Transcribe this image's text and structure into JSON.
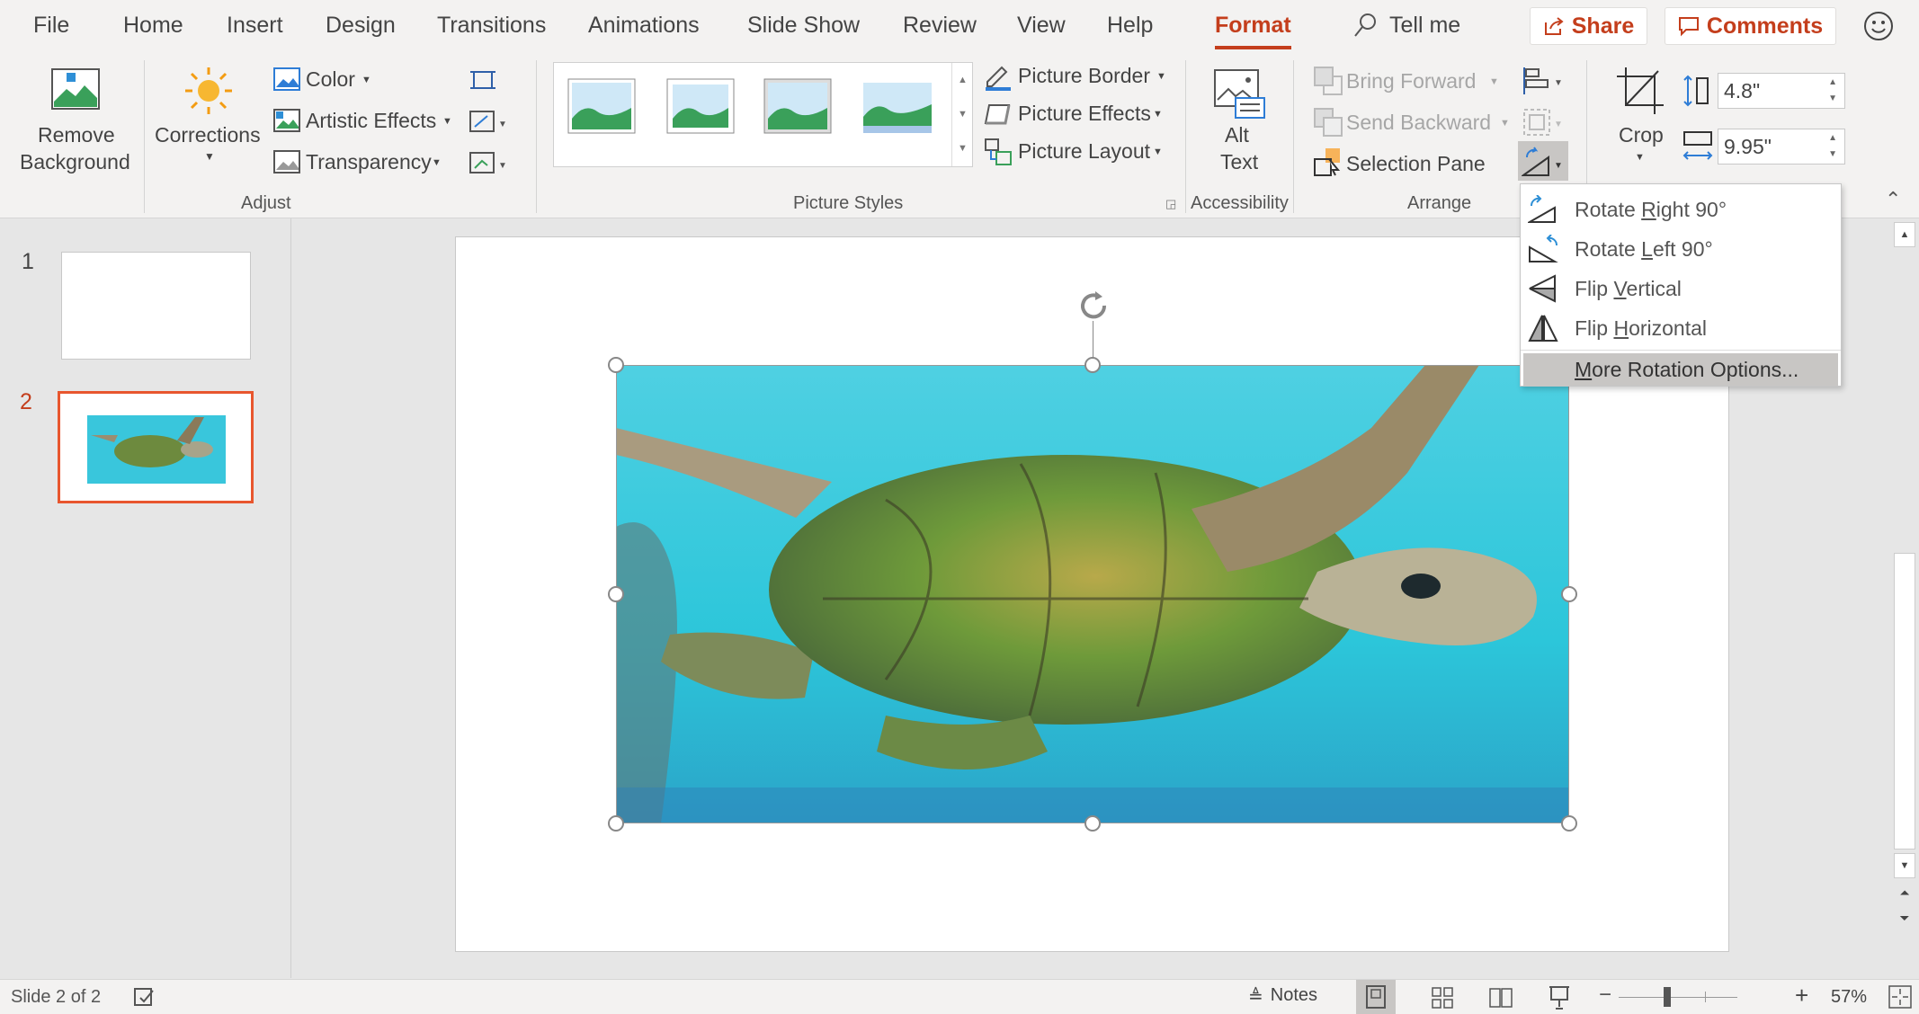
{
  "tabs": [
    "File",
    "Home",
    "Insert",
    "Design",
    "Transitions",
    "Animations",
    "Slide Show",
    "Review",
    "View",
    "Help",
    "Format"
  ],
  "active_tab": "Format",
  "tell_me": "Tell me",
  "share": "Share",
  "comments": "Comments",
  "accent": "#c43e1c",
  "ribbon": {
    "remove_background": [
      "Remove",
      "Background"
    ],
    "corrections": "Corrections",
    "color": "Color",
    "artistic_effects": "Artistic Effects",
    "transparency": "Transparency",
    "adjust": "Adjust",
    "picture_border": "Picture Border",
    "picture_effects": "Picture Effects",
    "picture_layout": "Picture Layout",
    "picture_styles": "Picture Styles",
    "alt_text": [
      "Alt",
      "Text"
    ],
    "accessibility": "Accessibility",
    "bring_forward": "Bring Forward",
    "send_backward": "Send Backward",
    "selection_pane": "Selection Pane",
    "arrange": "Arrange",
    "crop": "Crop",
    "height": "4.8\"",
    "width": "9.95\""
  },
  "rotate_menu": {
    "items": [
      {
        "pre": "Rotate ",
        "key": "R",
        "post": "ight 90°",
        "icon": "rotate-right-icon"
      },
      {
        "pre": "Rotate ",
        "key": "L",
        "post": "eft 90°",
        "icon": "rotate-left-icon"
      },
      {
        "pre": "Flip ",
        "key": "V",
        "post": "ertical",
        "icon": "flip-vertical-icon"
      },
      {
        "pre": "Flip ",
        "key": "H",
        "post": "orizontal",
        "icon": "flip-horizontal-icon"
      }
    ],
    "more": {
      "key": "M",
      "post": "ore Rotation Options..."
    }
  },
  "slides": [
    {
      "num": "1"
    },
    {
      "num": "2",
      "selected": true
    }
  ],
  "status": {
    "slide": "Slide 2 of 2",
    "notes": "Notes",
    "zoom": "57%",
    "zoom_percent": 57
  }
}
